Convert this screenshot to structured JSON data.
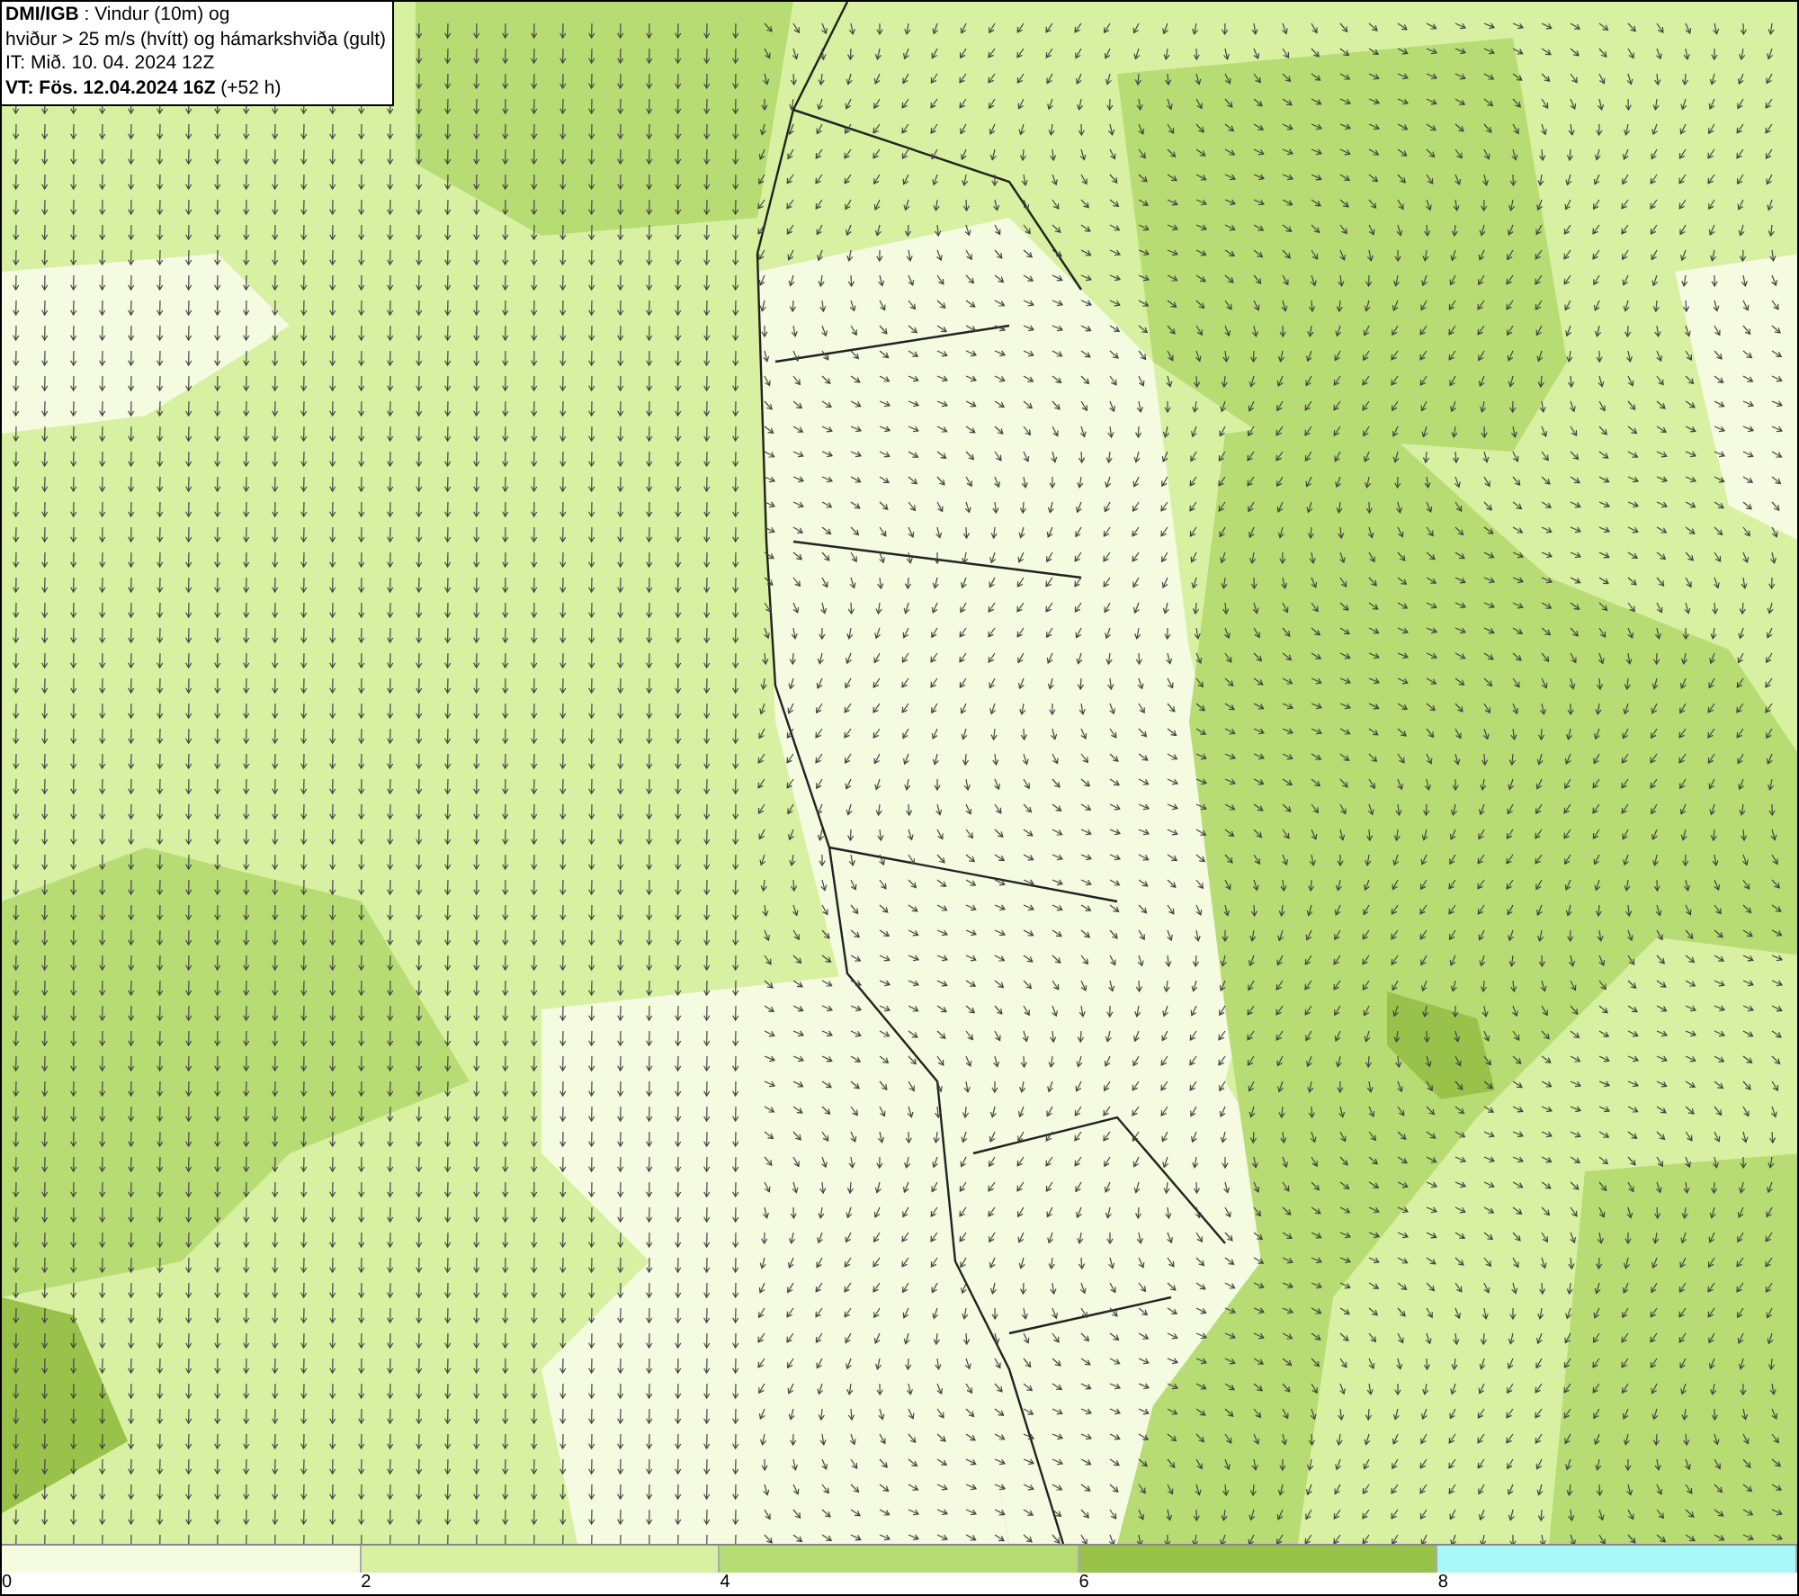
{
  "header": {
    "lines": [
      "**DMI/IGB** : Vindur (10m) og",
      "hviður > 25 m/s (hvítt) og hámarkshviða (gult)",
      "IT: Mið. 10. 04. 2024 12Z",
      "**VT: Fös. 12.04.2024 16Z** (+52 h)"
    ]
  },
  "colorbar": {
    "segments": [
      {
        "label": "0",
        "color": "#f4fbe0"
      },
      {
        "label": "2",
        "color": "#d8f0a2"
      },
      {
        "label": "4",
        "color": "#b8dc74"
      },
      {
        "label": "6",
        "color": "#98c24a"
      },
      {
        "label": "8",
        "color": "#a8f8f8"
      }
    ]
  }
}
